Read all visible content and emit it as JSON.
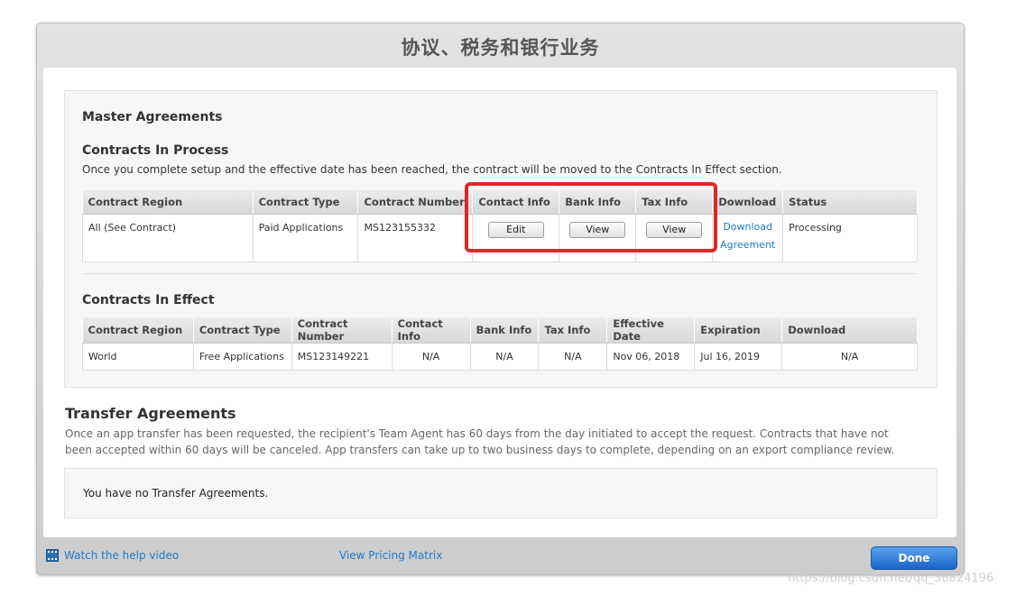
{
  "window": {
    "title": "协议、税务和银行业务"
  },
  "master": {
    "heading": "Master Agreements",
    "in_process": {
      "heading": "Contracts In Process",
      "description": "Once you complete setup and the effective date has been reached, the contract will be moved to the Contracts In Effect section.",
      "columns": [
        "Contract Region",
        "Contract Type",
        "Contract Number",
        "Contact Info",
        "Bank Info",
        "Tax Info",
        "Download",
        "Status"
      ],
      "row": {
        "region": "All (See Contract)",
        "type": "Paid Applications",
        "number": "MS123155332",
        "contact_btn": "Edit",
        "bank_btn": "View",
        "tax_btn": "View",
        "download_line1": "Download",
        "download_line2": "Agreement",
        "status": "Processing"
      }
    },
    "in_effect": {
      "heading": "Contracts In Effect",
      "columns": [
        "Contract Region",
        "Contract Type",
        "Contract Number",
        "Contact Info",
        "Bank Info",
        "Tax Info",
        "Effective Date",
        "Expiration",
        "Download"
      ],
      "row": {
        "region": "World",
        "type": "Free Applications",
        "number": "MS123149221",
        "contact": "N/A",
        "bank": "N/A",
        "tax": "N/A",
        "effective": "Nov 06, 2018",
        "expiration": "Jul 16, 2019",
        "download": "N/A"
      }
    }
  },
  "transfer": {
    "heading": "Transfer Agreements",
    "description": "Once an app transfer has been requested, the recipient's Team Agent has 60 days from the day initiated to accept the request. Contracts that have not been accepted within 60 days will be canceled. App transfers can take up to two business days to complete, depending on an export compliance review.",
    "empty": "You have no Transfer Agreements."
  },
  "footer": {
    "help_video": "Watch the help video",
    "pricing": "View Pricing Matrix",
    "done": "Done"
  },
  "watermark": "https://blog.csdn.net/qq_36824196",
  "colors": {
    "accent": "#1f79c7",
    "highlight": "#e32626",
    "done": "#1a63c7"
  },
  "icons": {
    "help_video": "film-icon"
  }
}
